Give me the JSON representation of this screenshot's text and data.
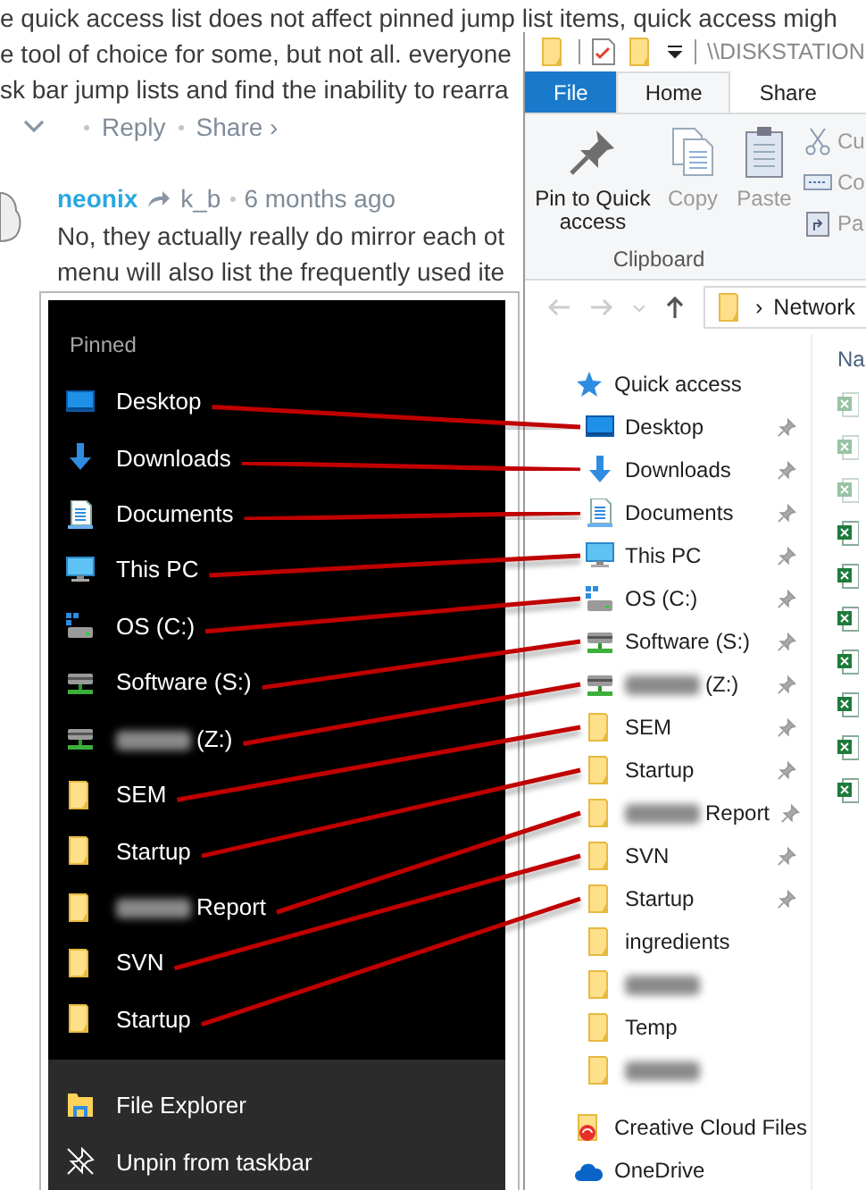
{
  "comment_page": {
    "text_lines": [
      "e quick access list does not affect pinned jump list items, quick access migh",
      "e tool of choice for some, but not all. everyone",
      "sk bar jump lists and find the inability to rearra"
    ],
    "actions": [
      "Reply",
      "Share ›"
    ],
    "comment": {
      "author": "neonix",
      "reply_to": "k_b",
      "time": "6 months ago",
      "text_lines": [
        "No, they actually really do mirror each ot",
        "menu will also list the frequently used ite"
      ]
    }
  },
  "explorer": {
    "title": "\\\\DISKSTATION",
    "ribbon_tabs": [
      {
        "label": "File",
        "kind": "file",
        "selected": false
      },
      {
        "label": "Home",
        "kind": "tab",
        "selected": true
      },
      {
        "label": "Share",
        "kind": "tab",
        "selected": false
      }
    ],
    "ribbon_buttons": [
      {
        "label": "Pin to Quick access",
        "kind": "pin",
        "disabled": false
      },
      {
        "label": "Copy",
        "kind": "copy",
        "disabled": true
      },
      {
        "label": "Paste",
        "kind": "paste",
        "disabled": true
      }
    ],
    "ribbon_small_buttons": [
      {
        "label": "Cu",
        "kind": "cut"
      },
      {
        "label": "Co",
        "kind": "path"
      },
      {
        "label": "Pa",
        "kind": "shortcut"
      }
    ],
    "ribbon_group": "Clipboard",
    "address_separator": "›",
    "address": "Network",
    "column_header": "Na",
    "nav_header": "Quick access",
    "nav_items": [
      {
        "label": "Desktop",
        "kind": "desktop",
        "pinned": true
      },
      {
        "label": "Downloads",
        "kind": "download",
        "pinned": true
      },
      {
        "label": "Documents",
        "kind": "documents",
        "pinned": true
      },
      {
        "label": "This PC",
        "kind": "pc",
        "pinned": true
      },
      {
        "label": "OS (C:)",
        "kind": "osdrive",
        "pinned": true
      },
      {
        "label": "Software (S:)",
        "kind": "netdrive",
        "pinned": true
      },
      {
        "label": "(Z:)",
        "kind": "netdrive",
        "pinned": true,
        "redacted": true
      },
      {
        "label": "SEM",
        "kind": "folder",
        "pinned": true
      },
      {
        "label": "Startup",
        "kind": "folder",
        "pinned": true
      },
      {
        "label": "Report",
        "kind": "folder",
        "pinned": true,
        "redacted": true
      },
      {
        "label": "SVN",
        "kind": "folder",
        "pinned": true
      },
      {
        "label": "Startup",
        "kind": "folder",
        "pinned": true
      },
      {
        "label": "ingredients",
        "kind": "folder",
        "pinned": false
      },
      {
        "kind": "folder",
        "pinned": false,
        "redacted": true
      },
      {
        "label": "Temp",
        "kind": "folder",
        "pinned": false
      },
      {
        "kind": "folder",
        "pinned": false,
        "redacted": true
      }
    ],
    "nav_roots": [
      {
        "label": "Creative Cloud Files",
        "kind": "creative"
      },
      {
        "label": "OneDrive",
        "kind": "onedrive"
      }
    ],
    "files": [
      {
        "dimmed": true
      },
      {
        "dimmed": true
      },
      {
        "dimmed": true
      },
      {
        "dimmed": false
      },
      {
        "dimmed": false
      },
      {
        "dimmed": false
      },
      {
        "dimmed": false
      },
      {
        "dimmed": false
      },
      {
        "dimmed": false
      },
      {
        "dimmed": false
      }
    ]
  },
  "jump_list": {
    "header": "Pinned",
    "items": [
      {
        "label": "Desktop",
        "kind": "desktop"
      },
      {
        "label": "Downloads",
        "kind": "download"
      },
      {
        "label": "Documents",
        "kind": "documents"
      },
      {
        "label": "This PC",
        "kind": "pc"
      },
      {
        "label": "OS (C:)",
        "kind": "osdrive"
      },
      {
        "label": "Software (S:)",
        "kind": "netdrive"
      },
      {
        "label": "(Z:)",
        "kind": "netdrive",
        "redacted": true
      },
      {
        "label": "SEM",
        "kind": "folder"
      },
      {
        "label": "Startup",
        "kind": "folder"
      },
      {
        "label": "Report",
        "kind": "folder",
        "redacted": true
      },
      {
        "label": "SVN",
        "kind": "folder"
      },
      {
        "label": "Startup",
        "kind": "folder"
      }
    ],
    "actions": [
      {
        "label": "File Explorer",
        "kind": "explorer"
      },
      {
        "label": "Unpin from taskbar",
        "kind": "unpin"
      }
    ]
  }
}
